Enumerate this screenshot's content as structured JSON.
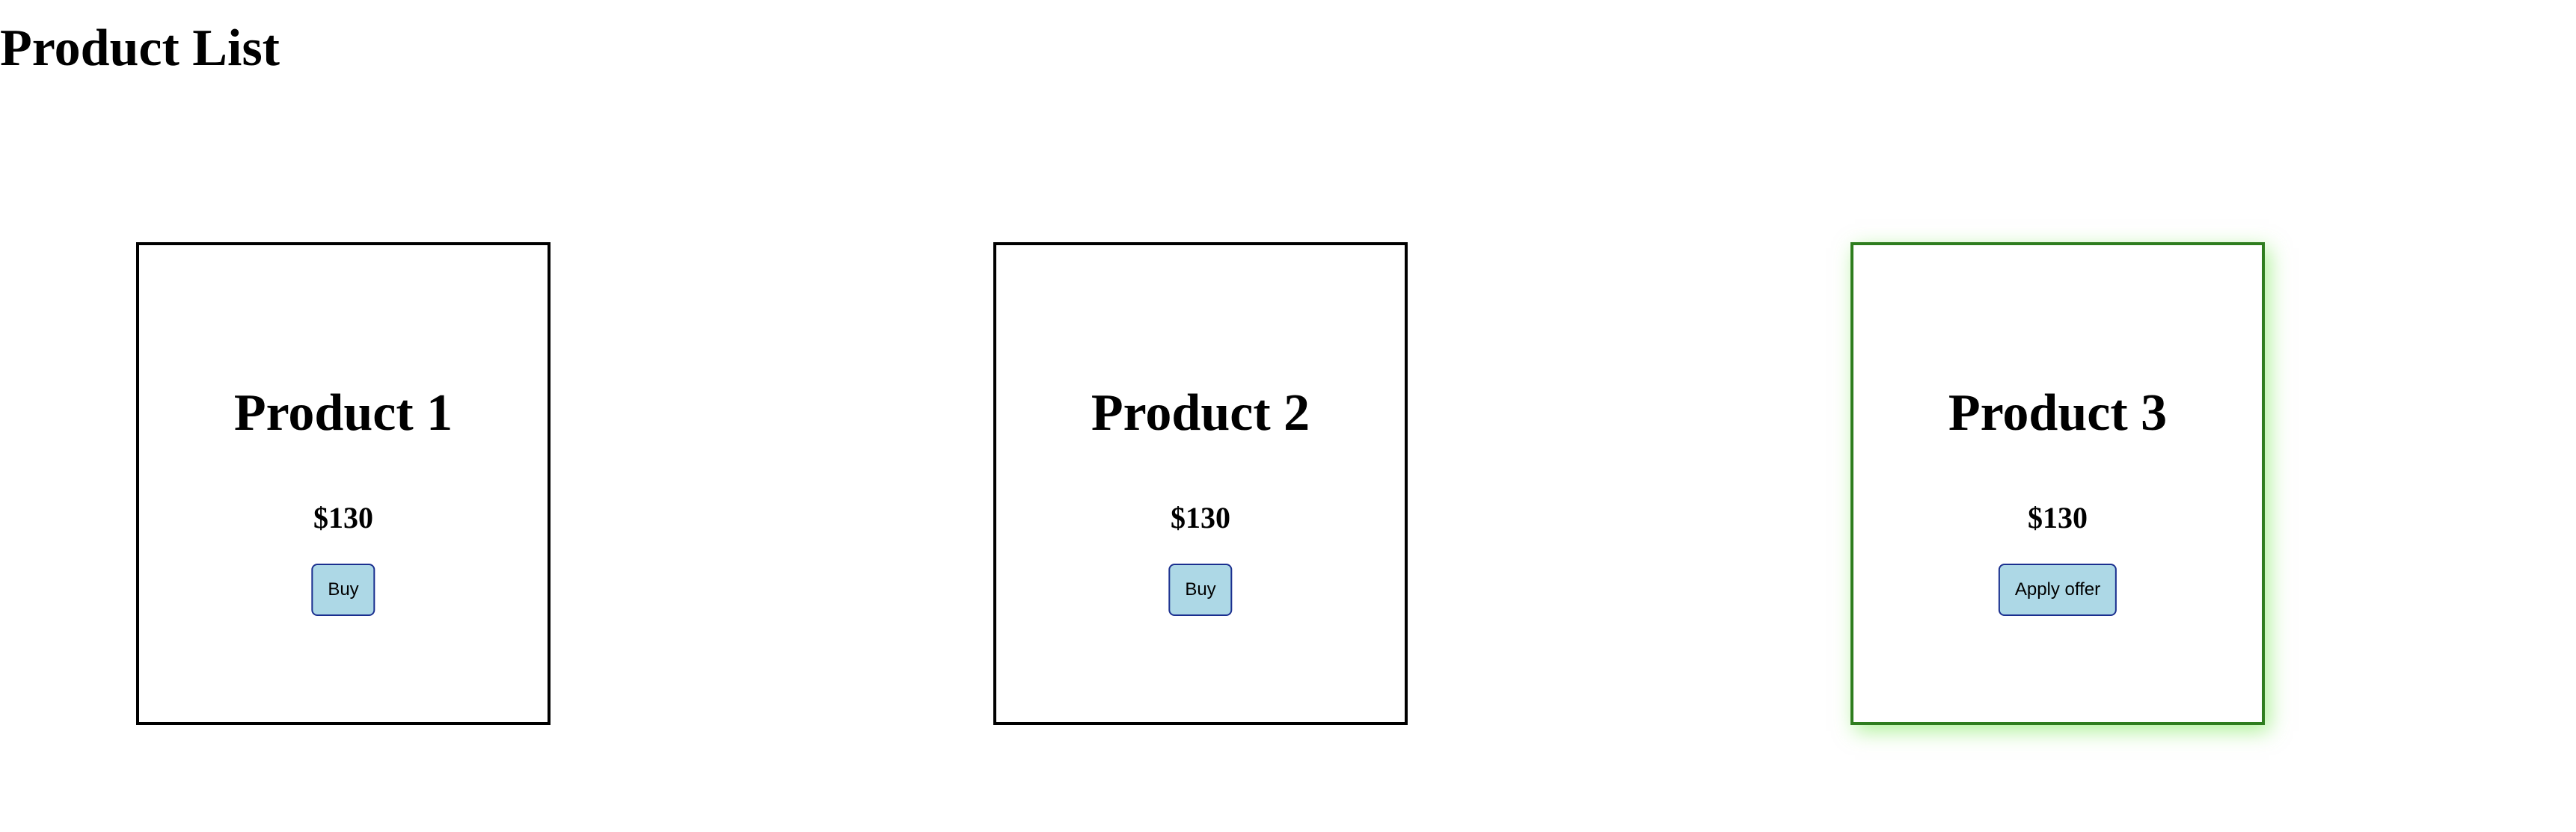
{
  "page": {
    "title": "Product List"
  },
  "products": [
    {
      "name": "Product 1",
      "price": "$130",
      "button_label": "Buy"
    },
    {
      "name": "Product 2",
      "price": "$130",
      "button_label": "Buy"
    },
    {
      "name": "Product 3",
      "price": "$130",
      "button_label": "Apply offer"
    }
  ],
  "colors": {
    "button_bg": "#add8e6",
    "button_border": "#1a2f8f",
    "featured_border": "#2e7d1e",
    "featured_glow": "#6ee646"
  }
}
